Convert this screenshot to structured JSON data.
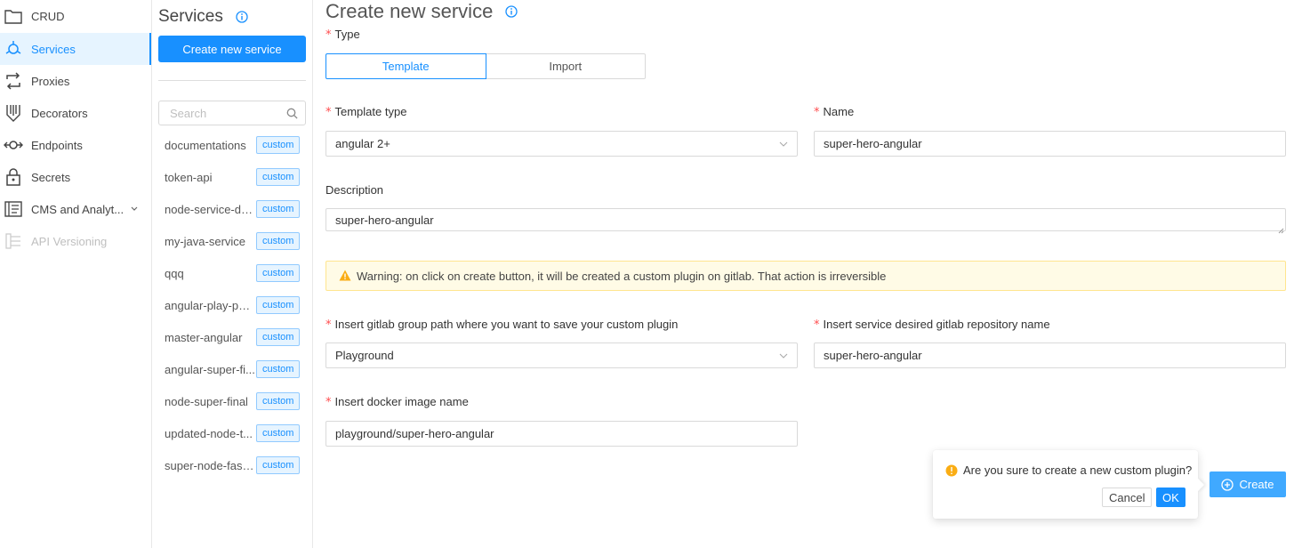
{
  "sidebar": {
    "items": [
      {
        "label": "CRUD",
        "icon": "folder-icon"
      },
      {
        "label": "Services",
        "icon": "services-icon",
        "active": true
      },
      {
        "label": "Proxies",
        "icon": "proxies-icon"
      },
      {
        "label": "Decorators",
        "icon": "decorators-icon"
      },
      {
        "label": "Endpoints",
        "icon": "endpoints-icon"
      },
      {
        "label": "Secrets",
        "icon": "lock-icon"
      },
      {
        "label": "CMS and Analyt...",
        "icon": "cms-icon",
        "has_submenu": true
      },
      {
        "label": "API Versioning",
        "icon": "api-versioning-icon",
        "disabled": true
      }
    ]
  },
  "services_panel": {
    "title": "Services",
    "create_button": "Create new service",
    "search_placeholder": "Search",
    "items": [
      {
        "name": "documentations",
        "tag": "custom"
      },
      {
        "name": "token-api",
        "tag": "custom"
      },
      {
        "name": "node-service-de...",
        "tag": "custom"
      },
      {
        "name": "my-java-service",
        "tag": "custom"
      },
      {
        "name": "qqq",
        "tag": "custom"
      },
      {
        "name": "angular-play-page",
        "tag": "custom"
      },
      {
        "name": "master-angular",
        "tag": "custom"
      },
      {
        "name": "angular-super-fi...",
        "tag": "custom"
      },
      {
        "name": "node-super-final",
        "tag": "custom"
      },
      {
        "name": "updated-node-t...",
        "tag": "custom"
      },
      {
        "name": "super-node-fastify",
        "tag": "custom"
      }
    ]
  },
  "form": {
    "title": "Create new service",
    "type_label": "Type",
    "type_options": [
      "Template",
      "Import"
    ],
    "type_selected": "Template",
    "template_type_label": "Template type",
    "template_type_value": "angular 2+",
    "name_label": "Name",
    "name_value": "super-hero-angular",
    "description_label": "Description",
    "description_value": "super-hero-angular",
    "warning_text": "Warning: on click on create button, it will be created a custom plugin on gitlab. That action is irreversible",
    "group_path_label": "Insert gitlab group path where you want to save your custom plugin",
    "group_path_value": "Playground",
    "repo_name_label": "Insert service desired gitlab repository name",
    "repo_name_value": "super-hero-angular",
    "docker_image_label": "Insert docker image name",
    "docker_image_value": "playground/super-hero-angular",
    "create_button": "Create"
  },
  "popconfirm": {
    "message": "Are you sure to create a new custom plugin?",
    "cancel": "Cancel",
    "ok": "OK"
  },
  "colors": {
    "primary": "#1890ff",
    "warning_bg": "#fffbe6",
    "warning_icon": "#faad14",
    "required": "#ff4d4f"
  }
}
